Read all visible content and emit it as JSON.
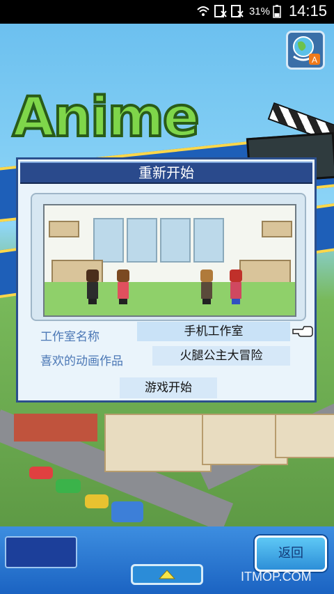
{
  "status_bar": {
    "battery_percent": "31%",
    "time": "14:15",
    "icons": [
      "wifi-icon",
      "no-sim-icon",
      "no-sim-icon",
      "battery-icon"
    ]
  },
  "app": {
    "logo_text": "Anime",
    "language_button_icon": "globe-language-icon",
    "language_badge": "A"
  },
  "dialog": {
    "title": "重新开始",
    "studio_name_label": "工作室名称",
    "studio_name_value": "手机工作室",
    "favorite_anime_label": "喜欢的动画作品",
    "favorite_anime_value": "火腿公主大冒险",
    "start_button": "游戏开始",
    "pointer_icon": "pointing-hand-icon"
  },
  "bottom_bar": {
    "back_button": "返回",
    "up_button_icon": "up-arrow-icon",
    "watermark": "ITMOP.COM"
  },
  "colors": {
    "dialog_title_bg": "#2a4a8c",
    "label_blue": "#4b77b5",
    "field_bg": "#d6e8f8",
    "bottom_bar": "#1b63c2"
  }
}
